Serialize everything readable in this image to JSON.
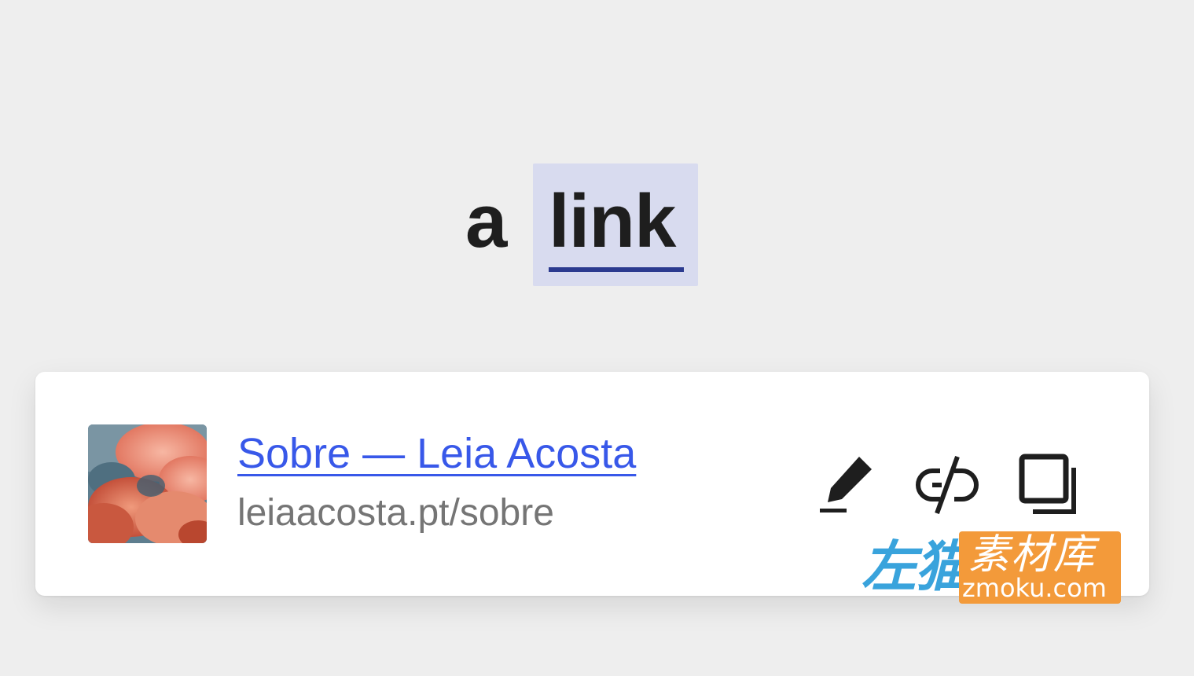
{
  "editor": {
    "word_before": "a",
    "link_text": "link",
    "highlight_color": "#d8dbef",
    "underline_color": "#2b3a8f"
  },
  "link_preview": {
    "title": "Sobre — Leia Acosta",
    "url": "leiaacosta.pt/sobre",
    "title_color": "#3858e9",
    "thumbnail": "pink-clouds-image",
    "actions": [
      {
        "name": "edit",
        "icon": "pencil-icon"
      },
      {
        "name": "unlink",
        "icon": "unlink-icon"
      },
      {
        "name": "copy",
        "icon": "copy-icon"
      }
    ]
  },
  "watermark": {
    "left_text": "左猫",
    "right_text": "素材库",
    "domain": "zmoku.com"
  }
}
